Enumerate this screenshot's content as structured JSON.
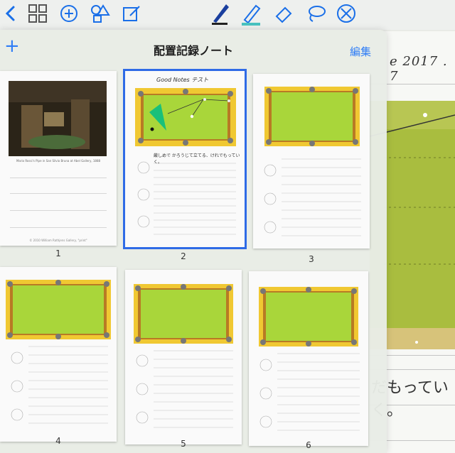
{
  "toolbar": {
    "icons": [
      "back-chevron-icon",
      "grid-icon",
      "add-circle-icon",
      "shapes-icon",
      "edit-icon",
      "pen-icon",
      "highlighter-icon",
      "eraser-icon",
      "lasso-icon",
      "close-circle-icon"
    ],
    "accent": "#1a6fe8"
  },
  "background_note": {
    "date_text": "e 2017 . 7",
    "handwriting": "だもっていく。"
  },
  "panel": {
    "title": "配置記録ノート",
    "add_label": "+",
    "edit_label": "編集"
  },
  "pages": [
    {
      "number": "1",
      "type": "photo",
      "caption": "Mario Rossi's Pipe in San Silvio Bruna at Abel Gallery, 1888",
      "footer": "© 2010 William Rathjens Gallery, \"print\""
    },
    {
      "number": "2",
      "type": "table",
      "selected": true,
      "heading": "Good Notes テスト",
      "note": "厳しめで かろうじて立てる、けれでもっていく。"
    },
    {
      "number": "3",
      "type": "table"
    },
    {
      "number": "4",
      "type": "table"
    },
    {
      "number": "5",
      "type": "table"
    },
    {
      "number": "6",
      "type": "table"
    }
  ]
}
